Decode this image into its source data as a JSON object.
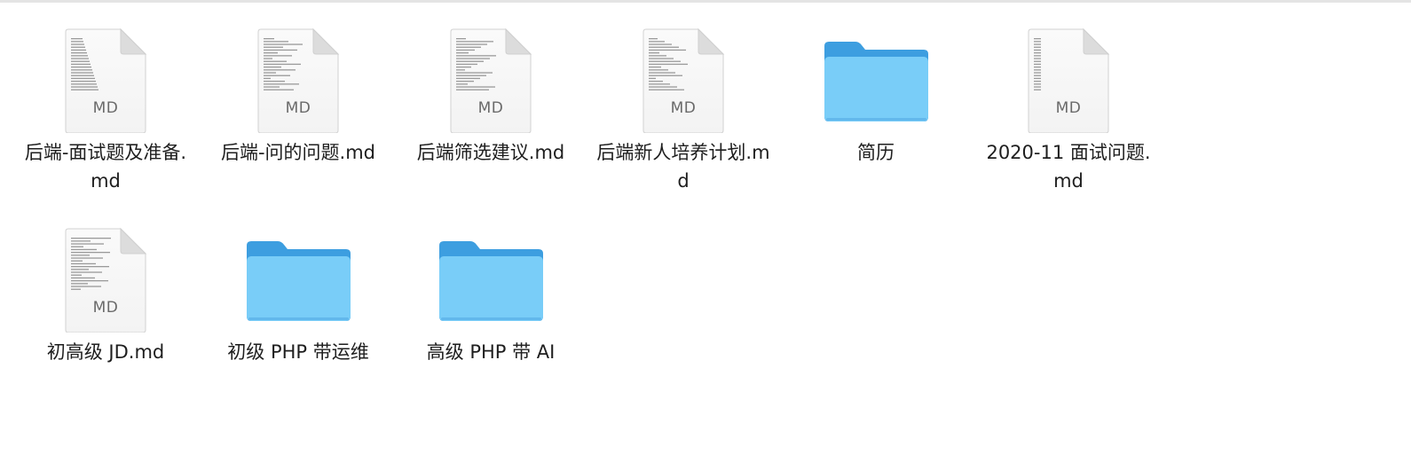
{
  "finder": {
    "items": [
      {
        "kind": "document",
        "extension": "MD",
        "name": "后端-面试题及准备.md"
      },
      {
        "kind": "document",
        "extension": "MD",
        "name": "后端-问的问题.md"
      },
      {
        "kind": "document",
        "extension": "MD",
        "name": "后端筛选建议.md"
      },
      {
        "kind": "document",
        "extension": "MD",
        "name": "后端新人培养计划.md"
      },
      {
        "kind": "folder",
        "name": "简历"
      },
      {
        "kind": "document",
        "extension": "MD",
        "name": "2020-11 面试问题.md"
      },
      {
        "kind": "document",
        "extension": "MD",
        "name": "初高级 JD.md"
      },
      {
        "kind": "folder",
        "name": "初级 PHP 带运维"
      },
      {
        "kind": "folder",
        "name": "高级 PHP 带 AI"
      }
    ],
    "colors": {
      "folder_back": "#3d9ee0",
      "folder_front": "#79cdf8",
      "document_page": "#f3f3f3",
      "document_fold": "#dcdcdc"
    }
  }
}
